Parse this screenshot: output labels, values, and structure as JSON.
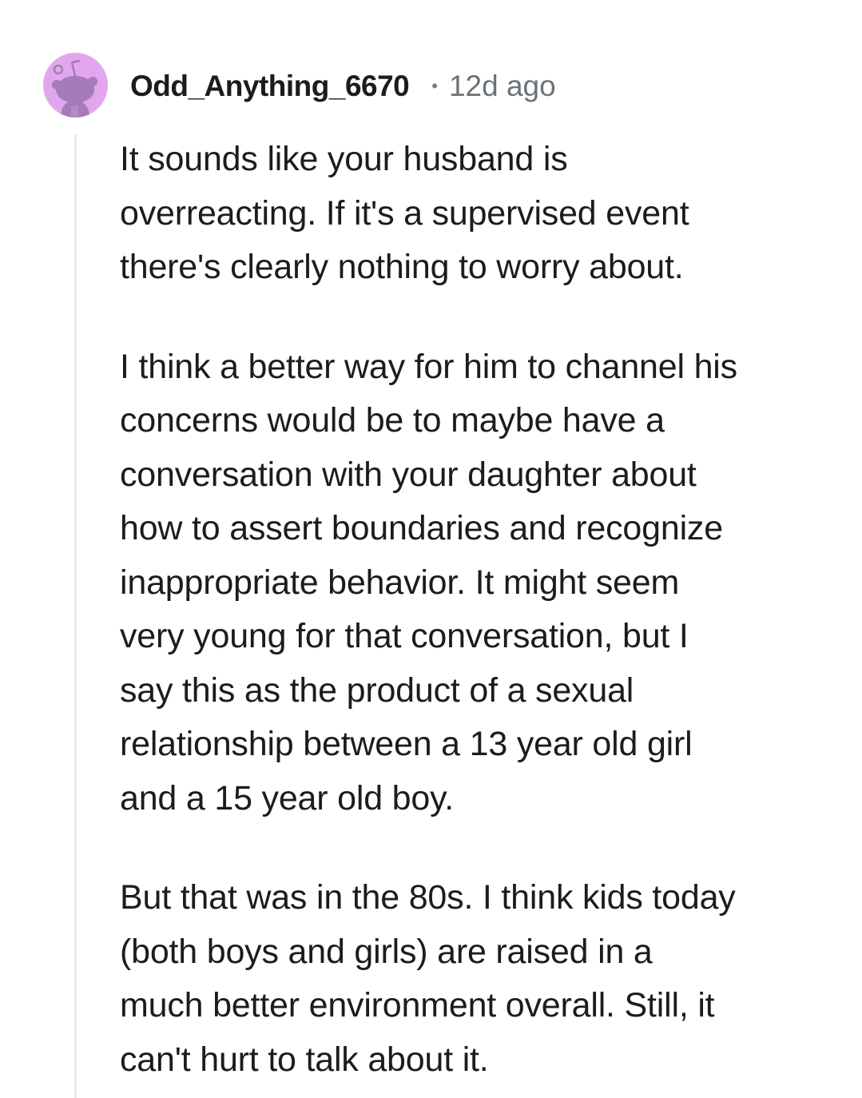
{
  "comment": {
    "username": "Odd_Anything_6670",
    "separator": "•",
    "timestamp": "12d ago",
    "avatar_icon": "reddit-snoo-icon",
    "colors": {
      "avatar_bg": "#e2a6ee",
      "avatar_figure": "#a57cb8",
      "thread_line": "#e8e8e8",
      "text": "#1c1c1c",
      "timestamp": "#6b7378"
    },
    "paragraphs": [
      {
        "lines": [
          "It sounds like your husband is",
          "overreacting. If it's a supervised event",
          "there's clearly nothing to worry about."
        ]
      },
      {
        "lines": [
          "I think a better way for him to channel his",
          "concerns would be to maybe have a",
          "conversation with your daughter about",
          "how to assert boundaries and recognize",
          "inappropriate behavior. It might seem",
          "very young for that conversation, but I",
          "say this as the product of a sexual",
          "relationship between a 13 year old girl",
          "and a 15 year old boy."
        ]
      },
      {
        "lines": [
          "But that was in the 80s. I think kids today",
          "(both boys and girls) are raised in a",
          "much better environment overall. Still, it",
          "can't hurt to talk about it."
        ]
      }
    ]
  }
}
